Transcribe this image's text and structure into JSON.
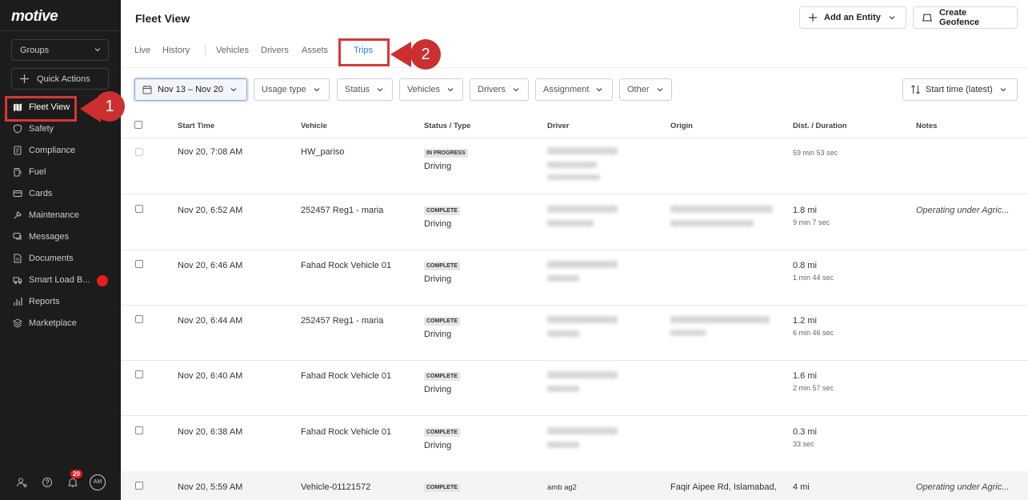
{
  "brand": {
    "logo": "motive"
  },
  "sidebar": {
    "groups_label": "Groups",
    "quick_actions_label": "Quick Actions",
    "items": [
      {
        "label": "Fleet View",
        "icon": "map-icon"
      },
      {
        "label": "Safety",
        "icon": "shield-icon"
      },
      {
        "label": "Compliance",
        "icon": "document-icon"
      },
      {
        "label": "Fuel",
        "icon": "fuel-icon"
      },
      {
        "label": "Cards",
        "icon": "card-icon"
      },
      {
        "label": "Maintenance",
        "icon": "wrench-icon"
      },
      {
        "label": "Messages",
        "icon": "chat-icon"
      },
      {
        "label": "Documents",
        "icon": "file-icon"
      },
      {
        "label": "Smart Load B...",
        "icon": "truck-icon"
      },
      {
        "label": "Reports",
        "icon": "chart-icon"
      },
      {
        "label": "Marketplace",
        "icon": "layers-icon"
      }
    ],
    "notifications_count": "20",
    "avatar_initials": "AM"
  },
  "header": {
    "title": "Fleet View",
    "add_entity_label": "Add an Entity",
    "create_geofence_label": "Create Geofence"
  },
  "tabs": [
    "Live",
    "History",
    "Vehicles",
    "Drivers",
    "Assets",
    "Trips"
  ],
  "active_tab": "Trips",
  "filters": {
    "date_range": "Nov 13 – Nov 20",
    "usage_type": "Usage type",
    "status": "Status",
    "vehicles": "Vehicles",
    "drivers": "Drivers",
    "assignment": "Assignment",
    "other": "Other",
    "sort": "Start time (latest)"
  },
  "table": {
    "columns": [
      "Start Time",
      "Vehicle",
      "Status / Type",
      "Driver",
      "Origin",
      "Dist. / Duration",
      "Notes"
    ],
    "rows": [
      {
        "start": "Nov 20, 7:08 AM",
        "vehicle": "HW_pariso",
        "status": "IN PROGRESS",
        "type": "Driving",
        "driver": "",
        "origin": "",
        "dist": "",
        "duration": "59 min 53 sec",
        "note": ""
      },
      {
        "start": "Nov 20, 6:52 AM",
        "vehicle": "252457 Reg1 - maria",
        "status": "COMPLETE",
        "type": "Driving",
        "driver": "",
        "origin": "",
        "dist": "1.8 mi",
        "duration": "9 min 7 sec",
        "note": "Operating under Agric..."
      },
      {
        "start": "Nov 20, 6:46 AM",
        "vehicle": "Fahad Rock Vehicle 01",
        "status": "COMPLETE",
        "type": "Driving",
        "driver": "",
        "origin": "",
        "dist": "0.8 mi",
        "duration": "1 min 44 sec",
        "note": ""
      },
      {
        "start": "Nov 20, 6:44 AM",
        "vehicle": "252457 Reg1 - maria",
        "status": "COMPLETE",
        "type": "Driving",
        "driver": "",
        "origin": "",
        "dist": "1.2 mi",
        "duration": "6 min 46 sec",
        "note": ""
      },
      {
        "start": "Nov 20, 6:40 AM",
        "vehicle": "Fahad Rock Vehicle 01",
        "status": "COMPLETE",
        "type": "Driving",
        "driver": "",
        "origin": "",
        "dist": "1.6 mi",
        "duration": "2 min 57 sec",
        "note": ""
      },
      {
        "start": "Nov 20, 6:38 AM",
        "vehicle": "Fahad Rock Vehicle 01",
        "status": "COMPLETE",
        "type": "Driving",
        "driver": "",
        "origin": "",
        "dist": "0.3 mi",
        "duration": "33 sec",
        "note": ""
      },
      {
        "start": "Nov 20, 5:59 AM",
        "vehicle": "Vehicle-01121572",
        "status": "COMPLETE",
        "type": "",
        "driver": "amb ag2",
        "origin": "Faqir Aipee Rd, Islamabad,",
        "dist": "4 mi",
        "duration": "",
        "note": "Operating under Agric..."
      }
    ]
  },
  "callouts": [
    "1",
    "2"
  ],
  "colors": {
    "accent": "#2b7de0",
    "highlight": "#d93636",
    "sidebar_bg": "#1c1c1c"
  }
}
